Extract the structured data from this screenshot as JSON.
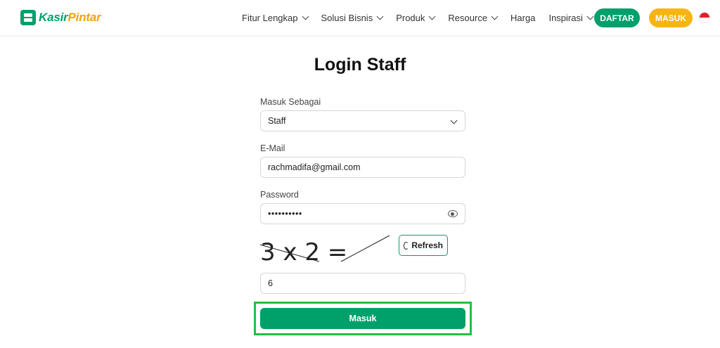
{
  "brand": {
    "name_part1": "Kasir",
    "name_part2": "Pintar"
  },
  "nav": {
    "items": [
      {
        "label": "Fitur Lengkap",
        "dropdown": true
      },
      {
        "label": "Solusi Bisnis",
        "dropdown": true
      },
      {
        "label": "Produk",
        "dropdown": true
      },
      {
        "label": "Resource",
        "dropdown": true
      },
      {
        "label": "Harga",
        "dropdown": false
      },
      {
        "label": "Inspirasi",
        "dropdown": true
      }
    ],
    "daftar_label": "DAFTAR",
    "masuk_label": "MASUK",
    "language_flag": "indonesia-flag-icon"
  },
  "form": {
    "title": "Login Staff",
    "role_label": "Masuk Sebagai",
    "role_value": "Staff",
    "email_label": "E-Mail",
    "email_value": "rachmadifa@gmail.com",
    "password_label": "Password",
    "password_value": "••••••••••",
    "captcha_text": "3 x 2 =",
    "refresh_label": "Refresh",
    "captcha_answer": "6",
    "submit_label": "Masuk"
  },
  "colors": {
    "primary": "#00a06b",
    "accent": "#f7b513",
    "highlight": "#23c043"
  }
}
